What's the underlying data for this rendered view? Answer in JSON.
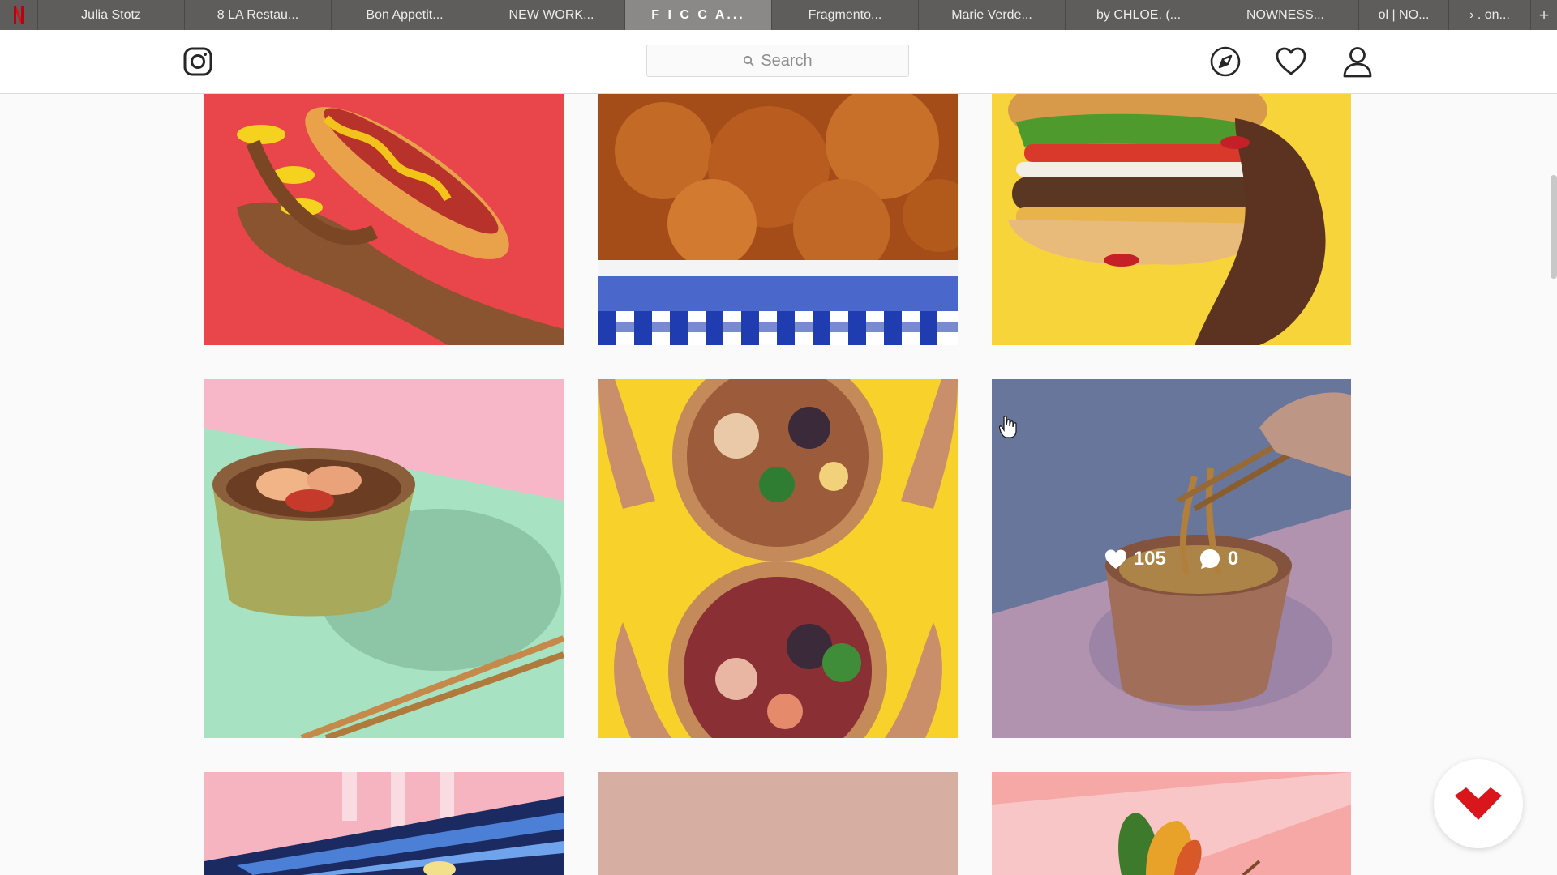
{
  "browser": {
    "tabs": [
      {
        "label": "Julia Stotz"
      },
      {
        "label": "8 LA Restau..."
      },
      {
        "label": "Bon Appetit..."
      },
      {
        "label": "NEW WORK..."
      },
      {
        "label": "F I C C A..."
      },
      {
        "label": "Fragmento..."
      },
      {
        "label": "Marie Verde..."
      },
      {
        "label": "by CHLOE. (..."
      },
      {
        "label": "NOWNESS..."
      },
      {
        "label": "ol | NO..."
      },
      {
        "label": "› . on..."
      }
    ],
    "active_tab_index": 4,
    "add_tab": "+"
  },
  "header": {
    "search_placeholder": "Search",
    "icons": [
      "instagram-logo-icon",
      "search-icon",
      "compass-icon",
      "heart-icon",
      "user-icon"
    ]
  },
  "grid": {
    "hovered_post": {
      "likes": "105",
      "comments": "0"
    }
  },
  "colors": {
    "tabbar": "#5e5d5b",
    "active_tab": "#8a8987",
    "fab_accent": "#d9161b"
  }
}
